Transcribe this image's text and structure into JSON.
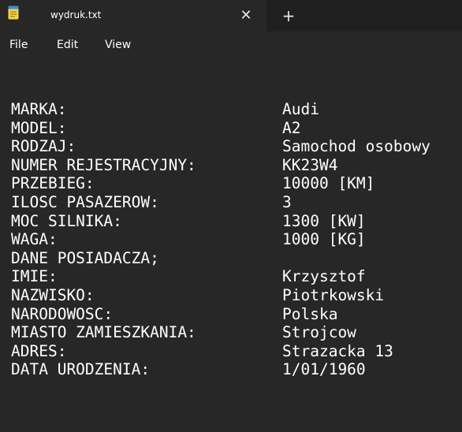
{
  "tab": {
    "title": "wydruk.txt",
    "close_glyph": "✕",
    "new_tab_glyph": "+",
    "icon": "notepad-icon"
  },
  "menu": {
    "items": [
      "File",
      "Edit",
      "View"
    ]
  },
  "document": {
    "lines": [
      {
        "key": "MARKA:",
        "value": "Audi"
      },
      {
        "key": "MODEL:",
        "value": "A2"
      },
      {
        "key": "RODZAJ:",
        "value": "Samochod osobowy"
      },
      {
        "key": "NUMER REJESTRACYJNY:",
        "value": "KK23W4"
      },
      {
        "key": "PRZEBIEG:",
        "value": "10000 [KM]"
      },
      {
        "key": "ILOSC PASAZEROW:",
        "value": "3"
      },
      {
        "key": "MOC SILNIKA:",
        "value": "1300 [KW]"
      },
      {
        "key": "WAGA:",
        "value": "1000 [KG]"
      },
      {
        "key": "DANE POSIADACZA;",
        "value": ""
      },
      {
        "key": "IMIE:",
        "value": "Krzysztof"
      },
      {
        "key": "NAZWISKO:",
        "value": "Piotrkowski"
      },
      {
        "key": "NARODOWOSC:",
        "value": "Polska"
      },
      {
        "key": "MIASTO ZAMIESZKANIA:",
        "value": "Strojcow"
      },
      {
        "key": "ADRES:",
        "value": "Strazacka 13"
      },
      {
        "key": "DATA URODZENIA:",
        "value": "1/01/1960"
      }
    ]
  }
}
